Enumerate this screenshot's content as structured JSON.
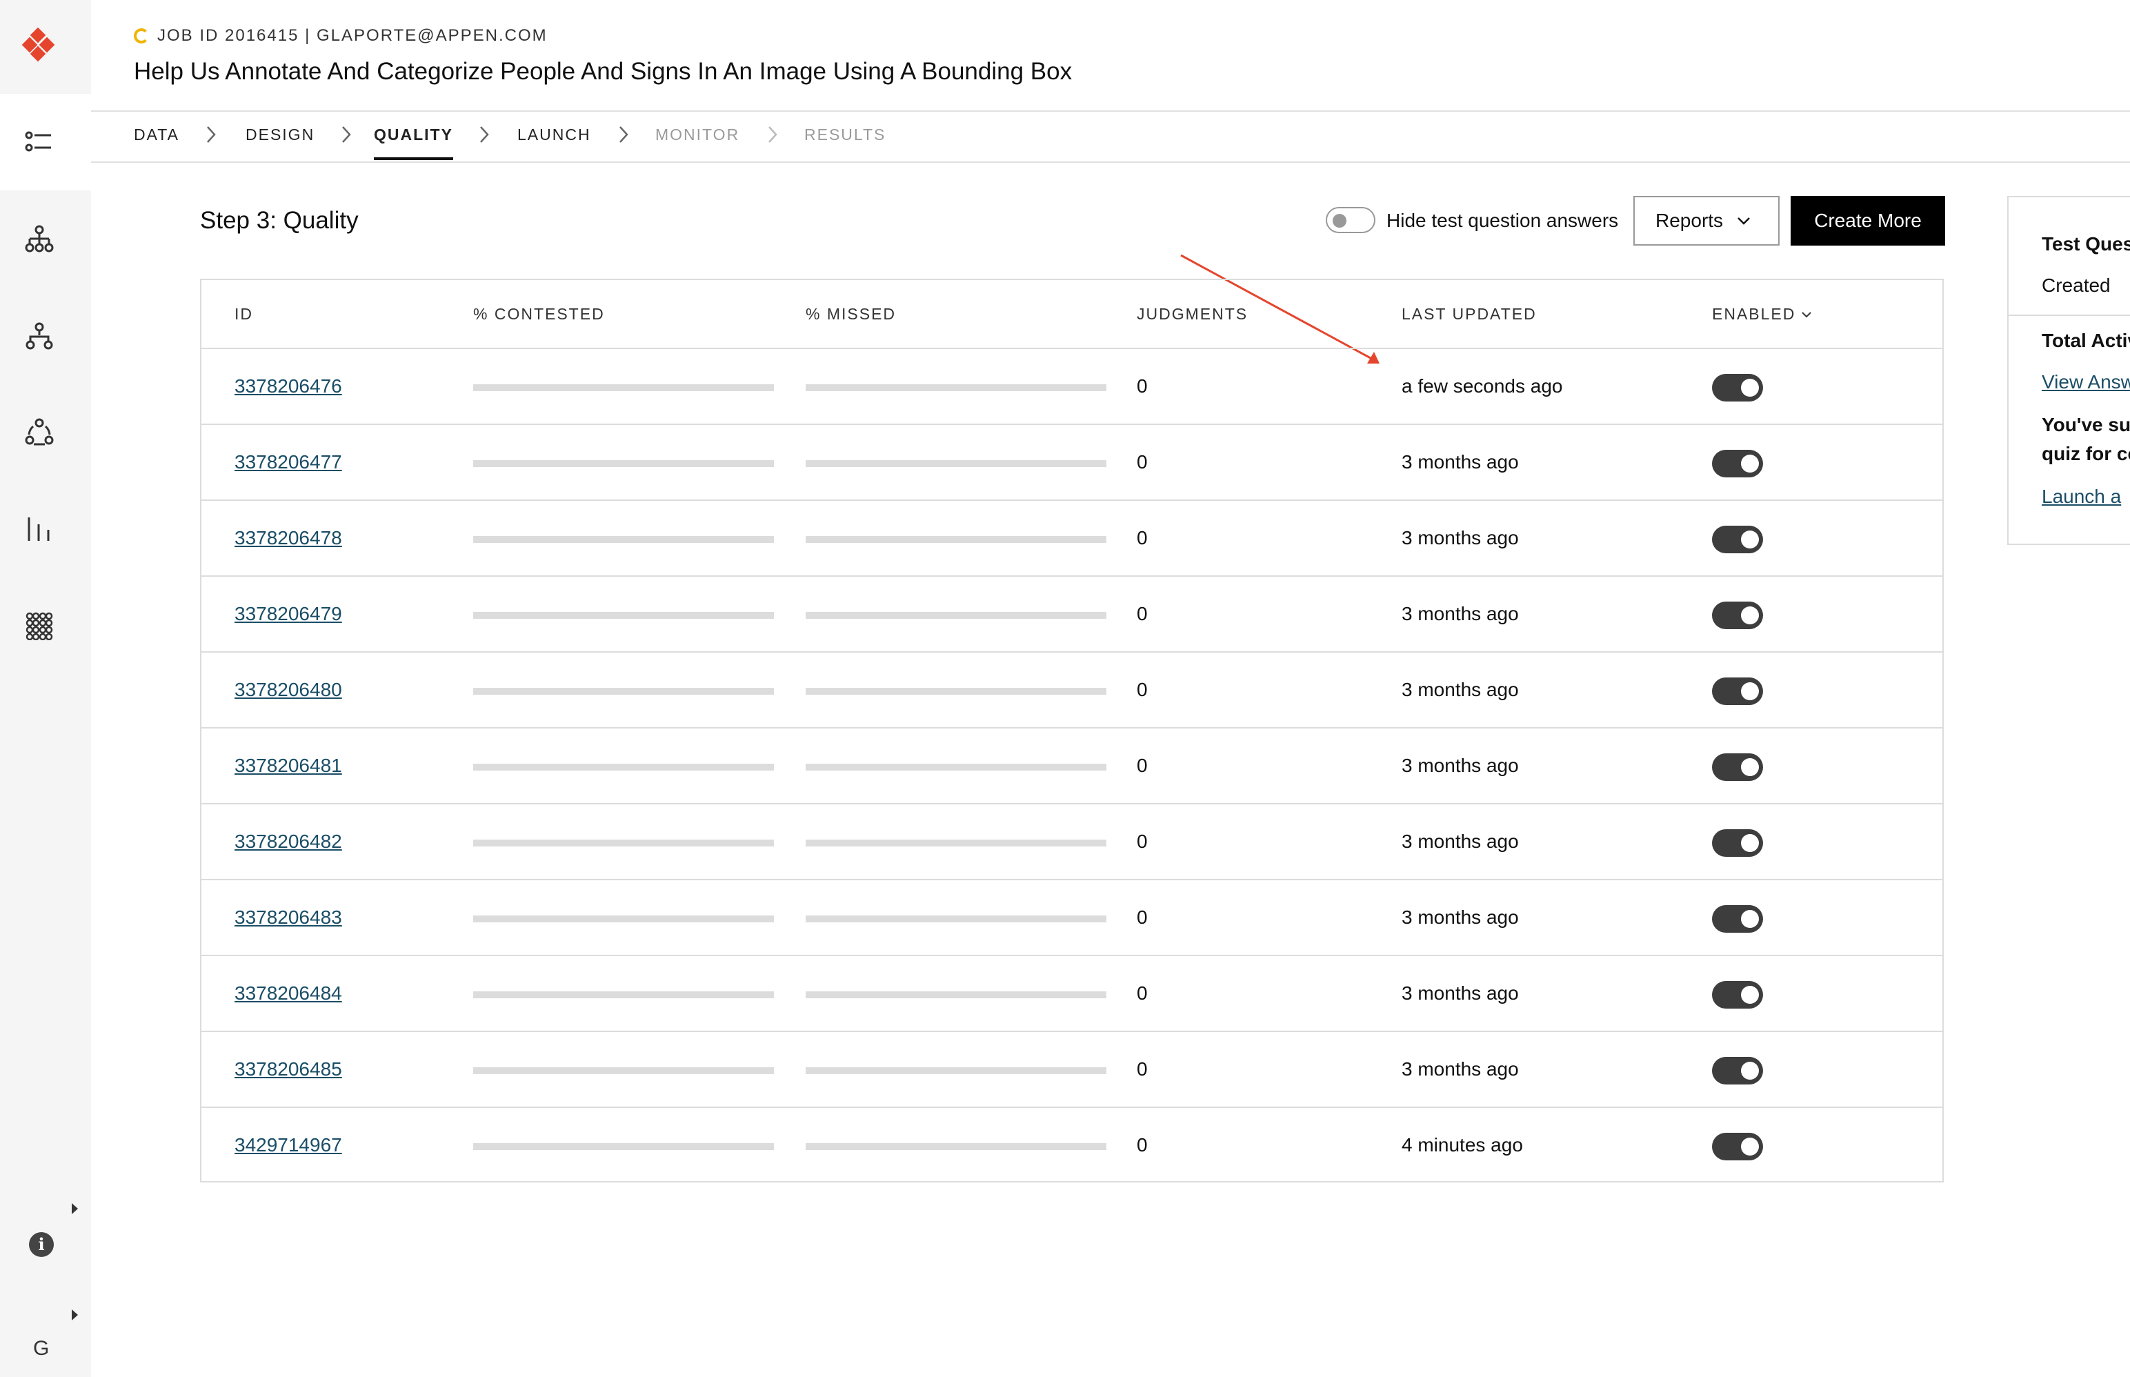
{
  "header": {
    "job_line": "JOB ID 2016415 | GLAPORTE@APPEN.COM",
    "title": "Help Us Annotate And Categorize People And Signs In An Image Using A Bounding Box"
  },
  "steps": [
    {
      "label": "DATA",
      "state": "done"
    },
    {
      "label": "DESIGN",
      "state": "done"
    },
    {
      "label": "QUALITY",
      "state": "active"
    },
    {
      "label": "LAUNCH",
      "state": "enabled"
    },
    {
      "label": "MONITOR",
      "state": "disabled"
    },
    {
      "label": "RESULTS",
      "state": "disabled"
    }
  ],
  "main": {
    "heading": "Step 3: Quality",
    "hide_toggle_label": "Hide test question answers",
    "reports_label": "Reports",
    "create_label": "Create More"
  },
  "table": {
    "columns": {
      "id": "ID",
      "contested": "% CONTESTED",
      "missed": "% MISSED",
      "judgments": "JUDGMENTS",
      "updated": "LAST UPDATED",
      "enabled": "ENABLED"
    },
    "rows": [
      {
        "id": "3378206476",
        "judgments": "0",
        "updated": "a few seconds ago",
        "enabled": true
      },
      {
        "id": "3378206477",
        "judgments": "0",
        "updated": "3 months ago",
        "enabled": true
      },
      {
        "id": "3378206478",
        "judgments": "0",
        "updated": "3 months ago",
        "enabled": true
      },
      {
        "id": "3378206479",
        "judgments": "0",
        "updated": "3 months ago",
        "enabled": true
      },
      {
        "id": "3378206480",
        "judgments": "0",
        "updated": "3 months ago",
        "enabled": true
      },
      {
        "id": "3378206481",
        "judgments": "0",
        "updated": "3 months ago",
        "enabled": true
      },
      {
        "id": "3378206482",
        "judgments": "0",
        "updated": "3 months ago",
        "enabled": true
      },
      {
        "id": "3378206483",
        "judgments": "0",
        "updated": "3 months ago",
        "enabled": true
      },
      {
        "id": "3378206484",
        "judgments": "0",
        "updated": "3 months ago",
        "enabled": true
      },
      {
        "id": "3378206485",
        "judgments": "0",
        "updated": "3 months ago",
        "enabled": true
      },
      {
        "id": "3429714967",
        "judgments": "0",
        "updated": "4 minutes ago",
        "enabled": true
      }
    ]
  },
  "side_panel": {
    "line1": "Test Ques",
    "line2": "Created",
    "line3": "Total Activ",
    "line4": "View Answ",
    "line5": "You've suc",
    "line6": "quiz for co",
    "line7": "Launch a "
  },
  "sidebar": {
    "g_label": "G",
    "icons": [
      "appen-logo-icon",
      "list-icon",
      "hierarchy-icon",
      "workflow-icon",
      "cycle-icon",
      "bar-chart-icon",
      "grid-apps-icon",
      "info-icon"
    ]
  },
  "colors": {
    "accent_red": "#e5452d",
    "link": "#1a4d66",
    "job_icon": "#f0b400"
  }
}
